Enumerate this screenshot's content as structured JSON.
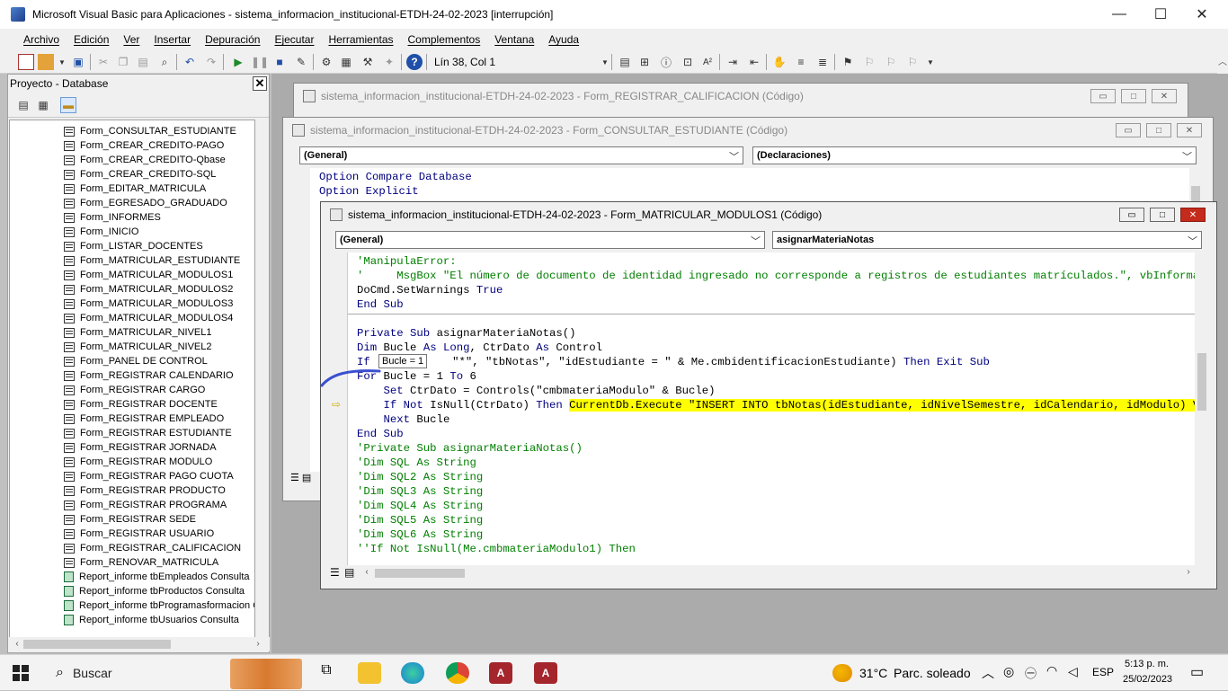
{
  "window": {
    "title": "Microsoft Visual Basic para Aplicaciones - sistema_informacion_institucional-ETDH-24-02-2023 [interrupción]"
  },
  "menu": [
    "Archivo",
    "Edición",
    "Ver",
    "Insertar",
    "Depuración",
    "Ejecutar",
    "Herramientas",
    "Complementos",
    "Ventana",
    "Ayuda"
  ],
  "toolbar": {
    "position": "Lín 38, Col 1"
  },
  "project": {
    "title": "Proyecto - Database",
    "items": [
      "Form_CONSULTAR_ESTUDIANTE",
      "Form_CREAR_CREDITO-PAGO",
      "Form_CREAR_CREDITO-Qbase",
      "Form_CREAR_CREDITO-SQL",
      "Form_EDITAR_MATRICULA",
      "Form_EGRESADO_GRADUADO",
      "Form_INFORMES",
      "Form_INICIO",
      "Form_LISTAR_DOCENTES",
      "Form_MATRICULAR_ESTUDIANTE",
      "Form_MATRICULAR_MODULOS1",
      "Form_MATRICULAR_MODULOS2",
      "Form_MATRICULAR_MODULOS3",
      "Form_MATRICULAR_MODULOS4",
      "Form_MATRICULAR_NIVEL1",
      "Form_MATRICULAR_NIVEL2",
      "Form_PANEL DE CONTROL",
      "Form_REGISTRAR CALENDARIO",
      "Form_REGISTRAR CARGO",
      "Form_REGISTRAR DOCENTE",
      "Form_REGISTRAR EMPLEADO",
      "Form_REGISTRAR ESTUDIANTE",
      "Form_REGISTRAR JORNADA",
      "Form_REGISTRAR MODULO",
      "Form_REGISTRAR PAGO CUOTA",
      "Form_REGISTRAR PRODUCTO",
      "Form_REGISTRAR PROGRAMA",
      "Form_REGISTRAR SEDE",
      "Form_REGISTRAR USUARIO",
      "Form_REGISTRAR_CALIFICACION",
      "Form_RENOVAR_MATRICULA"
    ],
    "reports": [
      "Report_informe tbEmpleados Consulta",
      "Report_informe tbProductos Consulta",
      "Report_informe tbProgramasformacion C",
      "Report_informe tbUsuarios Consulta"
    ]
  },
  "win1": {
    "title": "sistema_informacion_institucional-ETDH-24-02-2023 - Form_REGISTRAR_CALIFICACION (Código)"
  },
  "win2": {
    "title": "sistema_informacion_institucional-ETDH-24-02-2023 - Form_CONSULTAR_ESTUDIANTE (Código)",
    "object": "(General)",
    "proc": "(Declaraciones)",
    "lines": [
      "Option Compare Database",
      "Option Explicit"
    ]
  },
  "win3": {
    "title": "sistema_informacion_institucional-ETDH-24-02-2023 - Form_MATRICULAR_MODULOS1 (Código)",
    "object": "(General)",
    "proc": "asignarMateriaNotas",
    "tooltip": "Bucle = 1",
    "l1": "'ManipulaError:",
    "l2": "'     MsgBox \"El número de documento de identidad ingresado no corresponde a registros de estudiantes matrículados.\", vbInformation, \"",
    "l3a": "DoCmd.SetWarnings ",
    "l3b": "True",
    "l4": "End Sub",
    "l5a": "Private Sub ",
    "l5b": "asignarMateriaNotas()",
    "l6a": "Dim ",
    "l6b": "Bucle ",
    "l6c": "As Long",
    "l6d": ", CtrDato ",
    "l6e": "As",
    "l6f": " Control",
    "l7a": "If ",
    "l7b": "\"*\", \"tbNotas\", \"idEstudiante = \" & Me.cmbidentificacionEstudiante) ",
    "l7c": "Then Exit Sub",
    "l8a": "For ",
    "l8b": "Bucle = 1 ",
    "l8c": "To",
    "l8d": " 6",
    "l9a": "    Set ",
    "l9b": "CtrDato = Controls(\"cmbmateriaModulo\" & Bucle)",
    "l10a": "    If Not ",
    "l10b": "IsNull(CtrDato) ",
    "l10c": "Then ",
    "l10d": "CurrentDb.Execute \"INSERT INTO tbNotas(idEstudiante, idNivelSemestre, idCalendario, idModulo) VALUES (",
    "l11a": "    Next ",
    "l11b": "Bucle",
    "l12": "End Sub",
    "l13": "'Private Sub asignarMateriaNotas()",
    "l14": "'Dim SQL As String",
    "l15": "'Dim SQL2 As String",
    "l16": "'Dim SQL3 As String",
    "l17": "'Dim SQL4 As String",
    "l18": "'Dim SQL5 As String",
    "l19": "'Dim SQL6 As String",
    "l20": "''If Not IsNull(Me.cmbmateriaModulo1) Then"
  },
  "taskbar": {
    "search": "Buscar",
    "weather_temp": "31°C",
    "weather_text": "Parc. soleado",
    "lang": "ESP",
    "time": "5:13 p. m.",
    "date": "25/02/2023"
  },
  "colors": {
    "keyword": "#00007f",
    "comment": "#007f00",
    "highlight": "#ffff00",
    "accent": "#0067c0"
  }
}
